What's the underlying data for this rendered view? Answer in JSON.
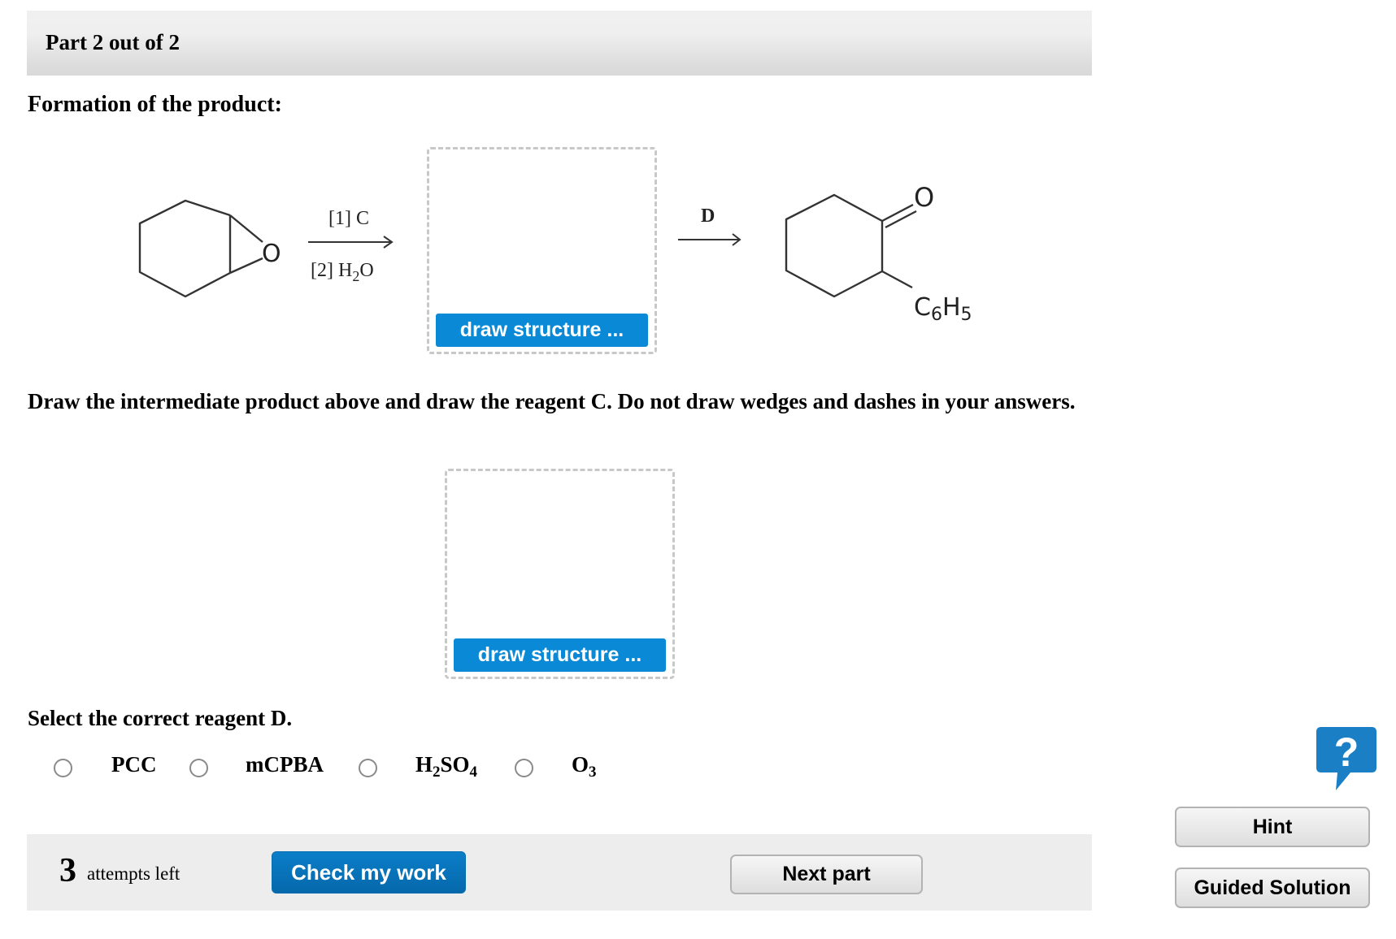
{
  "header": {
    "part_label": "Part 2 out of 2"
  },
  "section_title": "Formation of the product:",
  "reaction": {
    "starting_material": {
      "name": "cyclohexene oxide",
      "atom_label": "O"
    },
    "step1_arrow": {
      "above": "[1] C",
      "below_prefix": "[2] H",
      "below_sub": "2",
      "below_suffix": "O"
    },
    "step2_arrow": {
      "above": "D"
    },
    "product": {
      "name": "2-phenylcyclohexanone",
      "oxygen_label": "O",
      "substituent_main": "C",
      "substituent_sub1": "6",
      "substituent_h": "H",
      "substituent_sub2": "5"
    }
  },
  "draw_boxes": [
    {
      "id": "intermediate",
      "button_label": "draw structure ..."
    },
    {
      "id": "reagent-c",
      "button_label": "draw structure ..."
    }
  ],
  "instructions": "Draw the intermediate product above and draw the reagent C. Do not draw wedges and dashes in your answers.",
  "reagent_question": {
    "title": "Select the correct reagent D.",
    "options": [
      {
        "label_main": "PCC",
        "selected": false
      },
      {
        "label_main": "mCPBA",
        "selected": false
      },
      {
        "label_parts": [
          "H",
          "2",
          "SO",
          "4"
        ],
        "selected": false
      },
      {
        "label_parts": [
          "O",
          "3"
        ],
        "selected": false
      }
    ]
  },
  "footer": {
    "attempts_count": "3",
    "attempts_text": "attempts left",
    "check_button": "Check my work",
    "next_button": "Next part"
  },
  "sidebar": {
    "help_icon": "?",
    "hint_button": "Hint",
    "guided_button": "Guided Solution"
  },
  "colors": {
    "primary_blue": "#0a89d6",
    "check_blue": "#0a7ec8",
    "help_blue": "#1a7fc4",
    "footer_bg": "#ededed"
  }
}
